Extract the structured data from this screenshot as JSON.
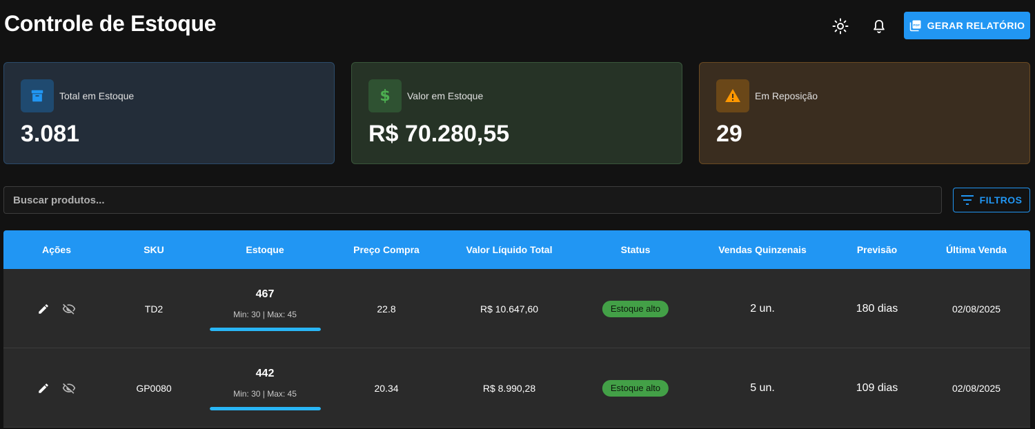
{
  "header": {
    "title": "Controle de Estoque",
    "report_button": "GERAR RELATÓRIO",
    "theme_icon": "sun-icon",
    "notifications_icon": "bell-icon",
    "report_icon": "pdf-icon"
  },
  "cards": [
    {
      "label": "Total em Estoque",
      "value": "3.081",
      "icon": "archive-box-icon",
      "accent": "#2196f3"
    },
    {
      "label": "Valor em Estoque",
      "value": "R$ 70.280,55",
      "icon": "dollar-icon",
      "accent": "#4caf50"
    },
    {
      "label": "Em Reposição",
      "value": "29",
      "icon": "warning-icon",
      "accent": "#ff9800"
    }
  ],
  "search": {
    "placeholder": "Buscar produtos...",
    "value": ""
  },
  "filters_button": "FILTROS",
  "table": {
    "columns": [
      "Ações",
      "SKU",
      "Estoque",
      "Preço Compra",
      "Valor Líquido Total",
      "Status",
      "Vendas Quinzenais",
      "Previsão",
      "Última Venda"
    ],
    "rows": [
      {
        "sku": "TD2",
        "stock": "467",
        "stock_range": "Min: 30 | Max: 45",
        "stock_level": 1.0,
        "purchase_price": "22.8",
        "net_total": "R$ 10.647,60",
        "status": "Estoque alto",
        "sales": "2 un.",
        "forecast": "180 dias",
        "last_sale": "02/08/2025"
      },
      {
        "sku": "GP0080",
        "stock": "442",
        "stock_range": "Min: 30 | Max: 45",
        "stock_level": 1.0,
        "purchase_price": "20.34",
        "net_total": "R$ 8.990,28",
        "status": "Estoque alto",
        "sales": "5 un.",
        "forecast": "109 dias",
        "last_sale": "02/08/2025"
      }
    ]
  },
  "colors": {
    "primary": "#2196f3",
    "status_high": "#43a047",
    "stock_bar": "#29b6f6",
    "background": "#121212",
    "row_bg": "#2a2a2a"
  }
}
